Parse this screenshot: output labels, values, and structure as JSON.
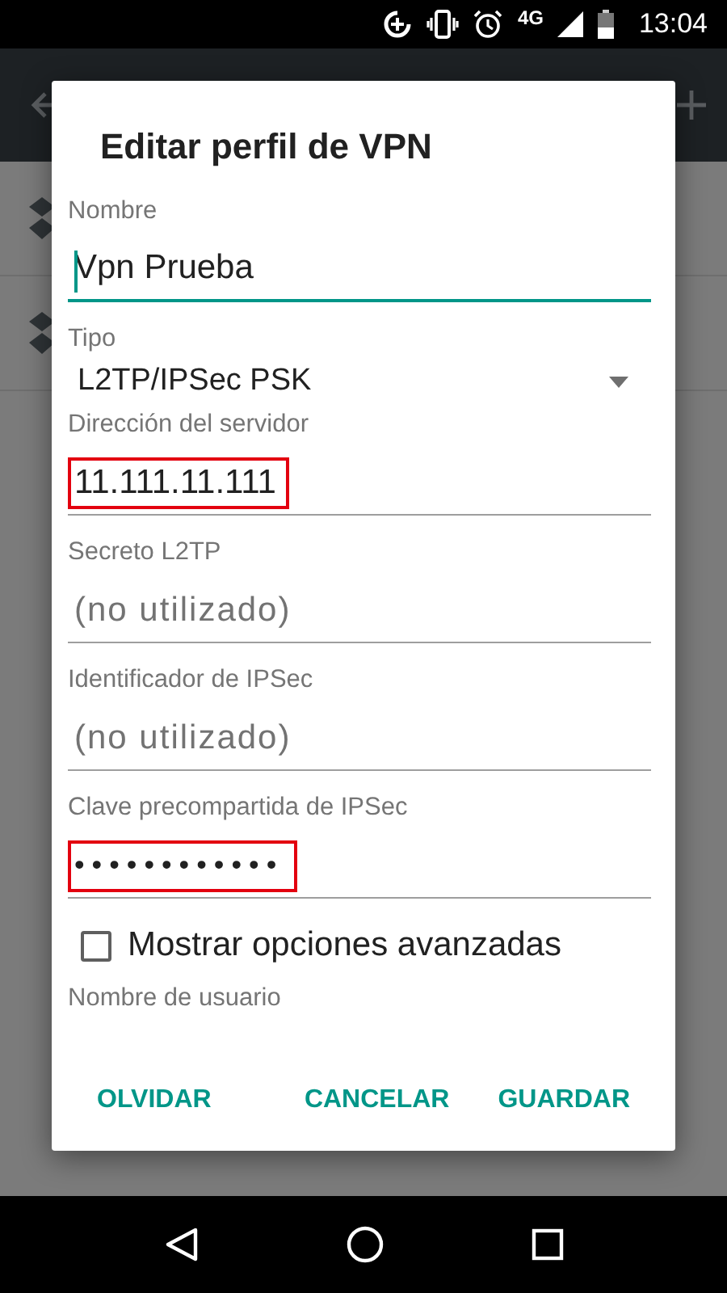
{
  "status_bar": {
    "network": "4G",
    "time": "13:04"
  },
  "dialog": {
    "title": "Editar perfil de VPN",
    "fields": [
      {
        "kind": "text",
        "label": "Nombre",
        "value": "Vpn Prueba",
        "focused": true,
        "highlighted": false
      },
      {
        "kind": "spinner",
        "label": "Tipo",
        "value": "L2TP/IPSec PSK"
      },
      {
        "kind": "text",
        "label": "Dirección del servidor",
        "value": "11.111.11.111",
        "focused": false,
        "highlighted": true
      },
      {
        "kind": "text",
        "label": "Secreto L2TP",
        "placeholder": "(no utilizado)",
        "focused": false,
        "highlighted": false
      },
      {
        "kind": "text",
        "label": "Identificador de IPSec",
        "placeholder": "(no utilizado)",
        "focused": false,
        "highlighted": false
      },
      {
        "kind": "password",
        "label": "Clave precompartida de IPSec",
        "value": "••••••••••••",
        "focused": false,
        "highlighted": true
      }
    ],
    "show_advanced": {
      "label": "Mostrar opciones avanzadas",
      "checked": false
    },
    "next_label": "Nombre de usuario",
    "buttons": [
      "OLVIDAR",
      "CANCELAR",
      "GUARDAR"
    ]
  }
}
